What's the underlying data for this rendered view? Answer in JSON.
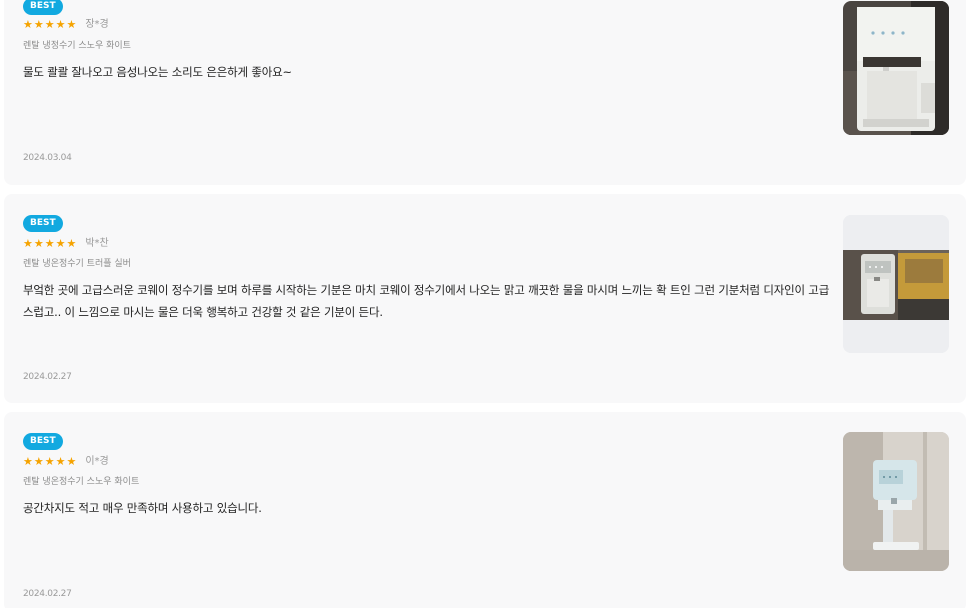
{
  "reviews": [
    {
      "badge": "BEST",
      "stars": "★★★★★",
      "rating": 5,
      "author": "장*경",
      "product": "렌탈 냉정수기 스노우 화이트",
      "text": "물도 콸콸 잘나오고 음성나오는 소리도 은은하게 좋아요~",
      "date": "2024.03.04"
    },
    {
      "badge": "BEST",
      "stars": "★★★★★",
      "rating": 5,
      "author": "박*찬",
      "product": "렌탈 냉온정수기 트러플 실버",
      "text": "부엌한 곳에 고급스러운 코웨이 정수기를 보며 하루를 시작하는 기분은 마치 코웨이 정수기에서 나오는 맑고 깨끗한 물을 마시며 느끼는 확 트인 그런 기분처럼 디자인이 고급스럽고.. 이 느낌으로 마시는 물은 더욱 행복하고 건강할 것 같은 기분이 든다.",
      "date": "2024.02.27"
    },
    {
      "badge": "BEST",
      "stars": "★★★★★",
      "rating": 5,
      "author": "이*경",
      "product": "렌탈 냉온정수기 스노우 화이트",
      "text": "공간차지도 적고 매우 만족하며 사용하고 있습니다.",
      "date": "2024.02.27"
    }
  ],
  "colors": {
    "card_bg": "#f8f8f9",
    "badge_bg": "#12a9e0",
    "star": "#f5a300",
    "text": "#222222",
    "muted": "#999999"
  }
}
